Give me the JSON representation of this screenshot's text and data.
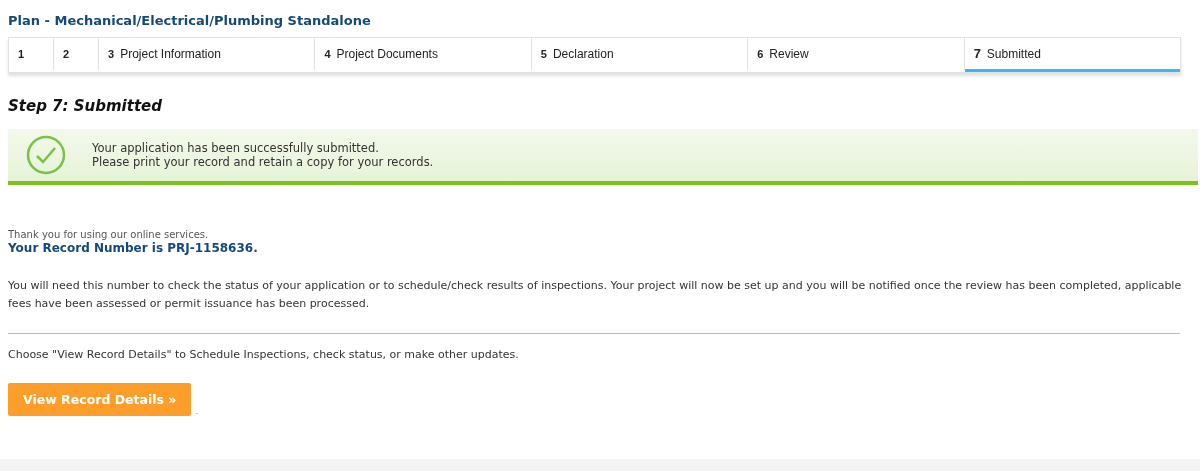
{
  "page_title": "Plan - Mechanical/Electrical/Plumbing Standalone",
  "steps": [
    {
      "number": "1",
      "selected": false
    },
    {
      "number": "2",
      "selected": false
    },
    {
      "number": "3",
      "label": "Project Information",
      "selected": false
    },
    {
      "number": "4",
      "label": "Project Documents",
      "selected": false
    },
    {
      "number": "5",
      "label": "Declaration",
      "selected": false
    },
    {
      "number": "6",
      "label": "Review",
      "selected": false
    },
    {
      "number": "7",
      "label": "Submitted",
      "selected": true
    }
  ],
  "step_heading": "Step 7: Submitted",
  "success_message": {
    "lines": [
      "Your application has been successfully submitted.",
      "Please print your record and retain a copy for your records."
    ]
  },
  "thanks": "Thank you for using our online services.",
  "record_number": "Your Record Number is PRJ-1158636.",
  "info": "You will need this number to check the status of your application or to schedule/check results of inspections. Your project will now be set up and you will be notified once the review has been completed, applicable fees have been assessed or permit issuance has been processed.",
  "choose_hint": "Choose \"View Record Details\" to Schedule Inspections, check status, or make other updates.",
  "button": "View Record Details »",
  "trailing_mark": "."
}
